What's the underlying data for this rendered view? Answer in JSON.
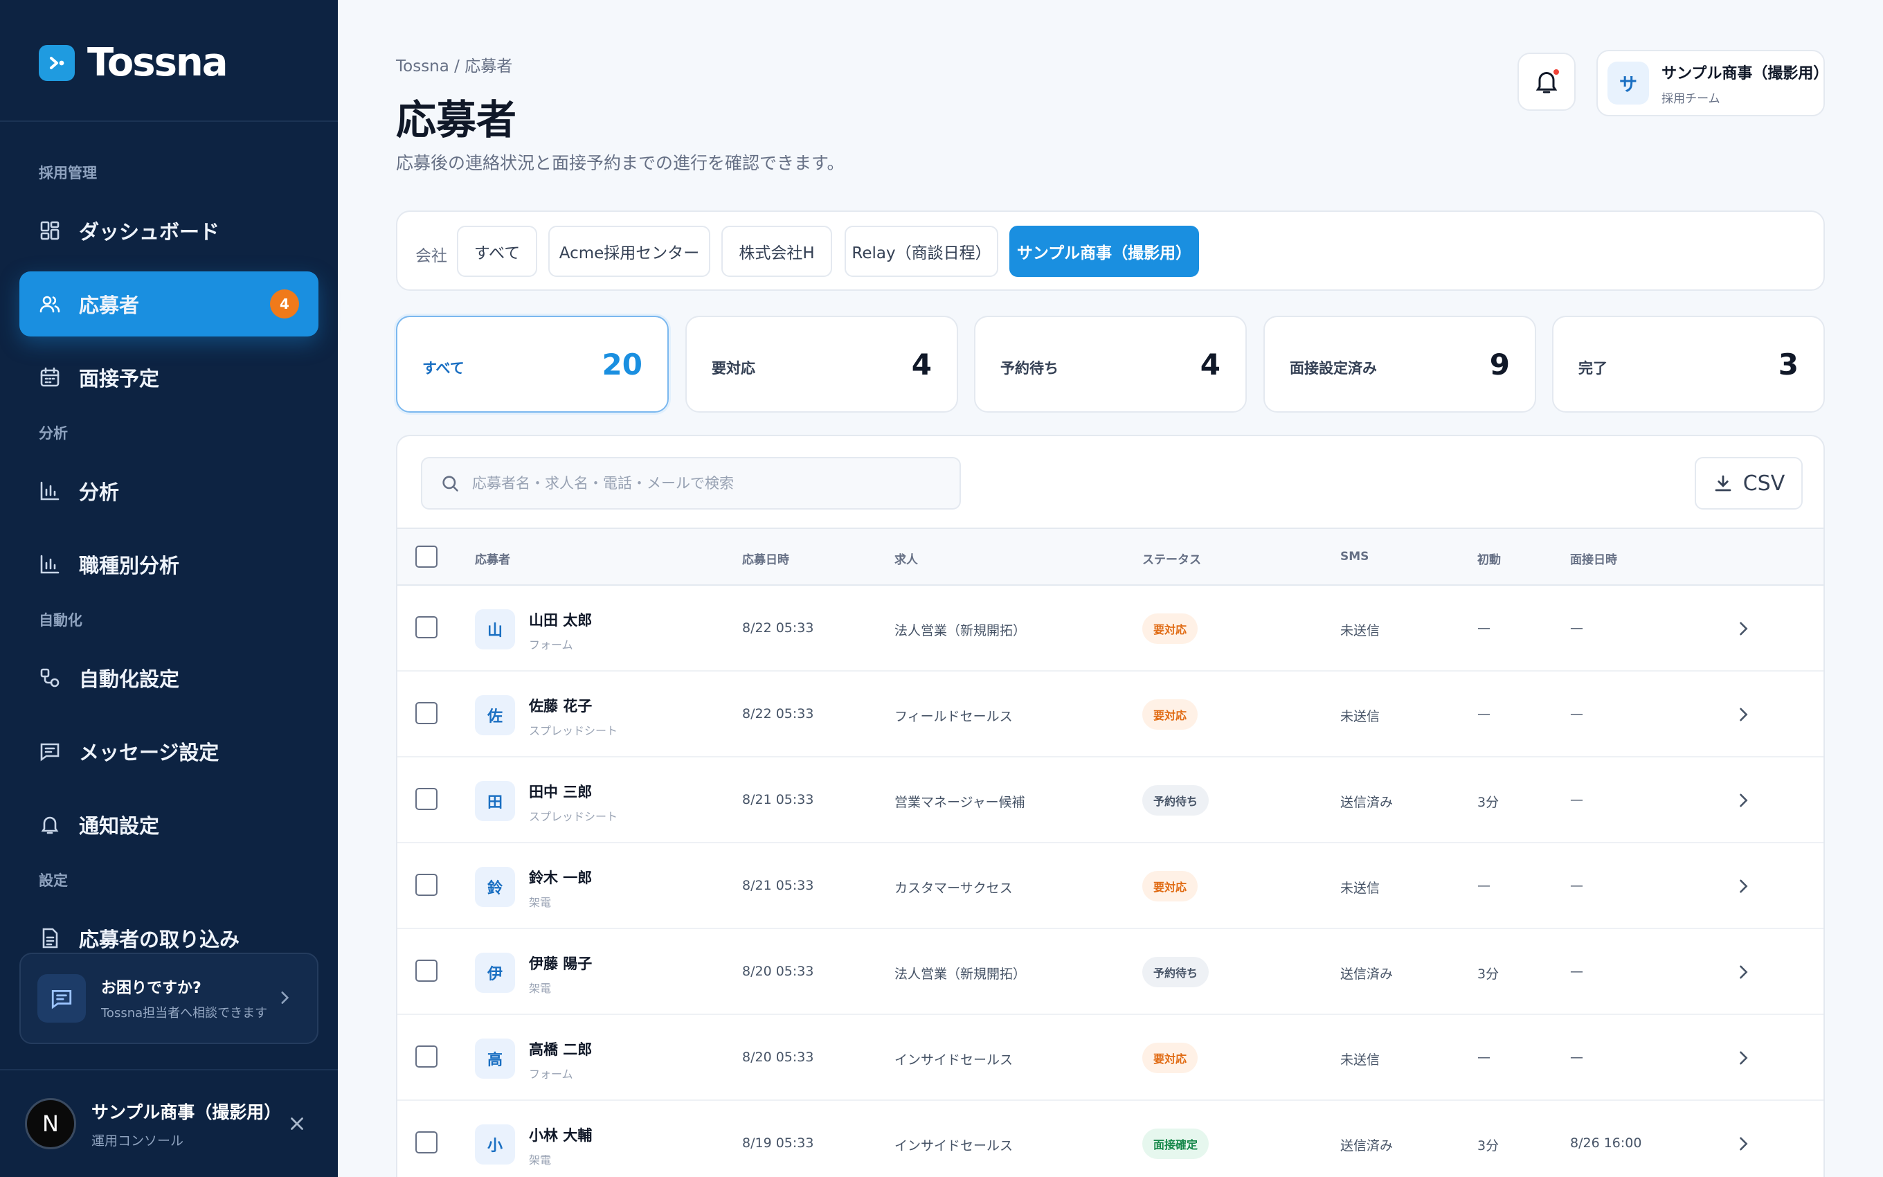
{
  "colors": {
    "sidebar": "#0d2342",
    "accent": "#1a8fe0",
    "badge": "#f07a1a",
    "urgent": "#e06a12",
    "confirmed": "#16884a"
  },
  "app": {
    "name": "Tossna"
  },
  "sidebar": {
    "sections": {
      "recruit": "採用管理",
      "analysis": "分析",
      "automation": "自動化",
      "settings": "設定"
    },
    "items": [
      {
        "label": "ダッシュボード",
        "icon": "dashboard-icon"
      },
      {
        "label": "応募者",
        "icon": "users-icon",
        "badge": "4",
        "active": true
      },
      {
        "label": "面接予定",
        "icon": "calendar-icon"
      },
      {
        "label": "分析",
        "icon": "bar-chart-icon"
      },
      {
        "label": "職種別分析",
        "icon": "bar-chart-icon"
      },
      {
        "label": "自動化設定",
        "icon": "workflow-icon"
      },
      {
        "label": "メッセージ設定",
        "icon": "message-icon"
      },
      {
        "label": "通知設定",
        "icon": "bell-icon"
      },
      {
        "label": "応募者の取り込み",
        "icon": "file-import-icon"
      }
    ],
    "help": {
      "title": "お困りですか?",
      "subtitle": "Tossna担当者へ相談できます"
    },
    "account": {
      "initial": "N",
      "name": "サンプル商事（撮影用）",
      "role": "運用コンソール"
    }
  },
  "header": {
    "breadcrumb": "Tossna / 応募者",
    "title": "応募者",
    "description": "応募後の連絡状況と面接予約までの進行を確認できます。",
    "user": {
      "initial": "サ",
      "name": "サンプル商事（撮影用）",
      "team": "採用チーム"
    }
  },
  "company_filter": {
    "label": "会社",
    "options": [
      "すべて",
      "Acme採用センター",
      "株式会社H",
      "Relay（商談日程）",
      "サンプル商事（撮影用）"
    ],
    "selected": "サンプル商事（撮影用）"
  },
  "stats": [
    {
      "label": "すべて",
      "value": "20",
      "active": true
    },
    {
      "label": "要対応",
      "value": "4"
    },
    {
      "label": "予約待ち",
      "value": "4"
    },
    {
      "label": "面接設定済み",
      "value": "9"
    },
    {
      "label": "完了",
      "value": "3"
    }
  ],
  "table": {
    "search_placeholder": "応募者名・求人名・電話・メールで検索",
    "csv_label": "CSV",
    "columns": [
      "応募者",
      "応募日時",
      "求人",
      "ステータス",
      "SMS",
      "初動",
      "面接日時"
    ],
    "rows": [
      {
        "initial": "山",
        "name": "山田 太郎",
        "source": "フォーム",
        "applied": "8/22 05:33",
        "job": "法人営業（新規開拓）",
        "status": "要対応",
        "status_type": "urgent",
        "sms": "未送信",
        "first": "—",
        "interview": "—"
      },
      {
        "initial": "佐",
        "name": "佐藤 花子",
        "source": "スプレッドシート",
        "applied": "8/22 05:33",
        "job": "フィールドセールス",
        "status": "要対応",
        "status_type": "urgent",
        "sms": "未送信",
        "first": "—",
        "interview": "—"
      },
      {
        "initial": "田",
        "name": "田中 三郎",
        "source": "スプレッドシート",
        "applied": "8/21 05:33",
        "job": "営業マネージャー候補",
        "status": "予約待ち",
        "status_type": "waiting",
        "sms": "送信済み",
        "first": "3分",
        "interview": "—"
      },
      {
        "initial": "鈴",
        "name": "鈴木 一郎",
        "source": "架電",
        "applied": "8/21 05:33",
        "job": "カスタマーサクセス",
        "status": "要対応",
        "status_type": "urgent",
        "sms": "未送信",
        "first": "—",
        "interview": "—"
      },
      {
        "initial": "伊",
        "name": "伊藤 陽子",
        "source": "架電",
        "applied": "8/20 05:33",
        "job": "法人営業（新規開拓）",
        "status": "予約待ち",
        "status_type": "waiting",
        "sms": "送信済み",
        "first": "3分",
        "interview": "—"
      },
      {
        "initial": "高",
        "name": "高橋 二郎",
        "source": "フォーム",
        "applied": "8/20 05:33",
        "job": "インサイドセールス",
        "status": "要対応",
        "status_type": "urgent",
        "sms": "未送信",
        "first": "—",
        "interview": "—"
      },
      {
        "initial": "小",
        "name": "小林 大輔",
        "source": "架電",
        "applied": "8/19 05:33",
        "job": "インサイドセールス",
        "status": "面接確定",
        "status_type": "done",
        "sms": "送信済み",
        "first": "3分",
        "interview": "8/26 16:00"
      }
    ]
  }
}
